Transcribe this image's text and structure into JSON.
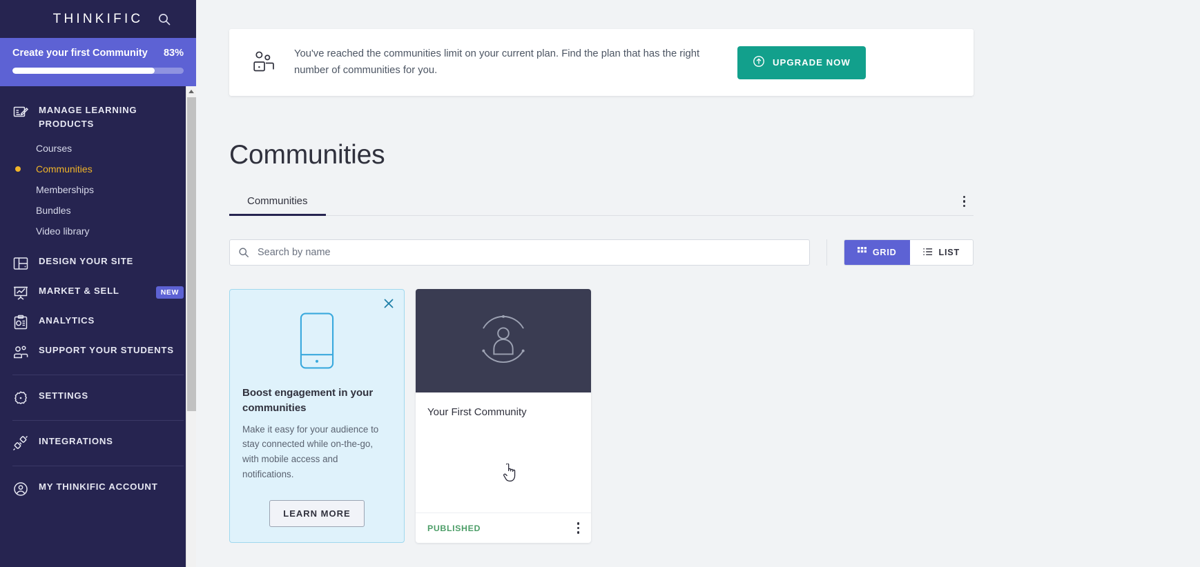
{
  "sidebar": {
    "logo": "THINKIFIC",
    "search_icon": "search-icon",
    "progress": {
      "title": "Create your first Community",
      "percent_label": "83%",
      "percent_value": 83
    },
    "nav": [
      {
        "label": "MANAGE LEARNING PRODUCTS",
        "icon": "edit-document-icon",
        "type": "main"
      },
      {
        "label": "Courses",
        "type": "sub",
        "active": false
      },
      {
        "label": "Communities",
        "type": "sub",
        "active": true
      },
      {
        "label": "Memberships",
        "type": "sub",
        "active": false
      },
      {
        "label": "Bundles",
        "type": "sub",
        "active": false
      },
      {
        "label": "Video library",
        "type": "sub",
        "active": false
      },
      {
        "label": "DESIGN YOUR SITE",
        "icon": "layout-icon",
        "type": "main"
      },
      {
        "label": "MARKET & SELL",
        "icon": "presentation-chart-icon",
        "type": "main",
        "badge": "NEW"
      },
      {
        "label": "ANALYTICS",
        "icon": "clipboard-chart-icon",
        "type": "main"
      },
      {
        "label": "SUPPORT YOUR STUDENTS",
        "icon": "people-icon",
        "type": "main"
      },
      {
        "label": "SETTINGS",
        "icon": "gear-icon",
        "type": "main"
      },
      {
        "label": "INTEGRATIONS",
        "icon": "plug-icon",
        "type": "main"
      },
      {
        "label": "MY THINKIFIC ACCOUNT",
        "icon": "user-circle-icon",
        "type": "main"
      }
    ]
  },
  "banner": {
    "icon": "people-group-icon",
    "text": "You've reached the communities limit on your current plan. Find the plan that has the right number of communities for you.",
    "button_label": "UPGRADE NOW",
    "button_icon": "arrow-up-circle-icon",
    "button_color": "#12a08c"
  },
  "page": {
    "title": "Communities"
  },
  "tabs": {
    "items": [
      {
        "label": "Communities",
        "active": true
      }
    ],
    "menu_icon": "more-vertical-icon"
  },
  "filters": {
    "search_placeholder": "Search by name",
    "search_value": "",
    "search_icon": "search-icon",
    "views": [
      {
        "label": "GRID",
        "icon": "grid-icon",
        "active": true
      },
      {
        "label": "LIST",
        "icon": "list-icon",
        "active": false
      }
    ]
  },
  "promo_card": {
    "close_icon": "close-icon",
    "image_icon": "mobile-phone-icon",
    "title": "Boost engagement in your communities",
    "body": "Make it easy for your audience to stay connected while on-the-go, with mobile access and notifications.",
    "button_label": "LEARN MORE"
  },
  "community_cards": [
    {
      "name": "Your First Community",
      "thumbnail_icon": "community-avatar-icon",
      "status": "PUBLISHED",
      "status_color": "#4d9e68",
      "menu_icon": "more-vertical-icon"
    }
  ],
  "colors": {
    "sidebar_bg": "#262450",
    "progress_bg": "#5d62d4",
    "accent_indigo": "#5d62d4",
    "accent_yellow": "#f0b429",
    "accent_teal": "#12a08c",
    "promo_bg": "#dff2fb",
    "page_bg": "#f1f3f5"
  }
}
